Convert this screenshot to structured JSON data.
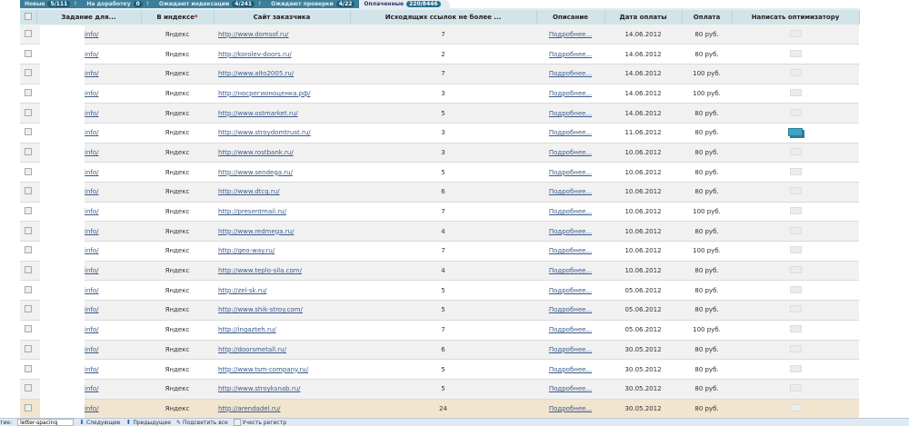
{
  "tabs": [
    {
      "label": "Новые",
      "count": "5/111"
    },
    {
      "label": "На доработку",
      "count": "0"
    },
    {
      "label": "Ожидают индексации",
      "count": "4/241"
    },
    {
      "label": "Ожидают проверки",
      "count": "4/22"
    },
    {
      "label": "Оплаченные",
      "count": "220/8446",
      "active": true
    }
  ],
  "headers": {
    "task": "Задание для...",
    "index": "В индексе",
    "index_star": "*",
    "site": "Сайт заказчика",
    "links": "Исходящих ссылок не более ...",
    "description": "Описание",
    "date": "Дата оплаты",
    "payment": "Оплата",
    "write": "Написать оптимизатору"
  },
  "rows": [
    {
      "task": "info/",
      "index": "Яндекс",
      "site": "http://www.domsof.ru/",
      "links": "7",
      "desc": "Подробнее...",
      "date": "14.06.2012",
      "pay": "80 руб."
    },
    {
      "task": "info/",
      "index": "Яндекс",
      "site": "http://korolev-doors.ru/",
      "links": "2",
      "desc": "Подробнее...",
      "date": "14.06.2012",
      "pay": "80 руб."
    },
    {
      "task": "info/",
      "index": "Яндекс",
      "site": "http://www.alto2005.ru/",
      "links": "7",
      "desc": "Подробнее...",
      "date": "14.06.2012",
      "pay": "100 руб."
    },
    {
      "task": "info/",
      "index": "Яндекс",
      "site": "http://носрегионоценка.рф/",
      "links": "3",
      "desc": "Подробнее...",
      "date": "14.06.2012",
      "pay": "100 руб."
    },
    {
      "task": "info/",
      "index": "Яндекс",
      "site": "http://www.ostmarket.ru/",
      "links": "5",
      "desc": "Подробнее...",
      "date": "14.06.2012",
      "pay": "80 руб."
    },
    {
      "task": "info/",
      "index": "Яндекс",
      "site": "http://www.stroydomtrust.ru/",
      "links": "3",
      "desc": "Подробнее...",
      "date": "11.06.2012",
      "pay": "80 руб.",
      "mail": "blue"
    },
    {
      "task": "info/",
      "index": "Яндекс",
      "site": "http://www.rostbank.ru/",
      "links": "3",
      "desc": "Подробнее...",
      "date": "10.06.2012",
      "pay": "80 руб."
    },
    {
      "task": "info/",
      "index": "Яндекс",
      "site": "http://www.sendega.ru/",
      "links": "5",
      "desc": "Подробнее...",
      "date": "10.06.2012",
      "pay": "80 руб."
    },
    {
      "task": "info/",
      "index": "Яндекс",
      "site": "http://www.dtcg.ru/",
      "links": "6",
      "desc": "Подробнее...",
      "date": "10.06.2012",
      "pay": "80 руб."
    },
    {
      "task": "info/",
      "index": "Яндекс",
      "site": "http://presentmail.ru/",
      "links": "7",
      "desc": "Подробнее...",
      "date": "10.06.2012",
      "pay": "100 руб."
    },
    {
      "task": "info/",
      "index": "Яндекс",
      "site": "http://www.redmega.ru/",
      "links": "4",
      "desc": "Подробнее...",
      "date": "10.06.2012",
      "pay": "80 руб."
    },
    {
      "task": "info/",
      "index": "Яндекс",
      "site": "http://geo-way.ru/",
      "links": "7",
      "desc": "Подробнее...",
      "date": "10.06.2012",
      "pay": "100 руб."
    },
    {
      "task": "info/",
      "index": "Яндекс",
      "site": "http://www.teplo-sila.com/",
      "links": "4",
      "desc": "Подробнее...",
      "date": "10.06.2012",
      "pay": "80 руб."
    },
    {
      "task": "info/",
      "index": "Яндекс",
      "site": "http://zel-sk.ru/",
      "links": "5",
      "desc": "Подробнее...",
      "date": "05.06.2012",
      "pay": "80 руб."
    },
    {
      "task": "info/",
      "index": "Яндекс",
      "site": "http://www.shik-stroy.com/",
      "links": "5",
      "desc": "Подробнее...",
      "date": "05.06.2012",
      "pay": "80 руб."
    },
    {
      "task": "info/",
      "index": "Яндекс",
      "site": "http://ingazteh.ru/",
      "links": "7",
      "desc": "Подробнее...",
      "date": "05.06.2012",
      "pay": "100 руб."
    },
    {
      "task": "info/",
      "index": "Яндекс",
      "site": "http://doorsmetall.ru/",
      "links": "6",
      "desc": "Подробнее...",
      "date": "30.05.2012",
      "pay": "80 руб."
    },
    {
      "task": "info/",
      "index": "Яндекс",
      "site": "http://www.tsm-company.ru/",
      "links": "5",
      "desc": "Подробнее...",
      "date": "30.05.2012",
      "pay": "80 руб."
    },
    {
      "task": "info/",
      "index": "Яндекс",
      "site": "http://www.stroyksnab.ru/",
      "links": "5",
      "desc": "Подробнее...",
      "date": "30.05.2012",
      "pay": "80 руб."
    },
    {
      "task": "info/",
      "index": "Яндекс",
      "site": "http://arendadel.ru/",
      "links": "24",
      "desc": "Подробнее...",
      "date": "30.05.2012",
      "pay": "80 руб.",
      "highlight": true
    }
  ],
  "findbar": {
    "label": "тие:",
    "value": "letter-spacing",
    "next": "Следующее",
    "prev": "Предыдущее",
    "highlight": "Подсветить все",
    "case": "Учесть регистр"
  }
}
